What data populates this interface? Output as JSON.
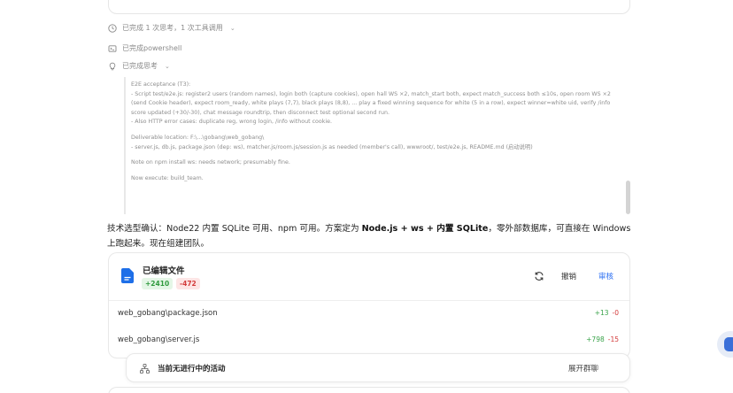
{
  "status": {
    "completed_thinking": "已完成 1 次思考，1 次工具调用",
    "completed_powershell": "已完成powershell",
    "completed_thought": "已完成思考"
  },
  "thinking": {
    "paragraphs": [
      "E2E acceptance (T3):\n- Script test/e2e.js: register2 users (random names), login both (capture cookies), open hall WS ×2, match_start both, expect match_success both ≤10s, open room WS ×2 (send Cookie header), expect room_ready, white plays (7,7), black plays (8,8), ... play a fixed winning sequence for white (5 in a row), expect winner=white uid, verify /info score updated (+30/-30), chat message roundtrip, then disconnect test optional second run.\n- Also HTTP error cases: duplicate reg, wrong login, /info without cookie.",
      "Deliverable location: F:\\...\\gobang\\web_gobang\\\n- server.js, db.js, package.json (dep: ws), matcher.js/room.js/session.js as needed (member's call), wwwroot/, test/e2e.js, README.md (启动说明)",
      "Note on npm install ws: needs network; presumably fine.",
      "Now execute: build_team."
    ]
  },
  "answer": {
    "prefix": "技术选型确认：Node22 内置 SQLite 可用、npm 可用。方案定为 ",
    "stack": "Node.js + ws + 内置 SQLite",
    "suffix": "，零外部数据库，可直接在 Windows 上跑起来。现在组建团队。"
  },
  "files_card": {
    "title": "已编辑文件",
    "added": "+2410",
    "removed": "-472",
    "undo_label": "撤销",
    "review_label": "审核",
    "files": [
      {
        "name": "web_gobang\\package.json",
        "added": "+13",
        "removed": "-0"
      },
      {
        "name": "web_gobang\\server.js",
        "added": "+798",
        "removed": "-15"
      }
    ]
  },
  "activity": {
    "text": "当前无进行中的活动",
    "expand_label": "展开群聊"
  },
  "colors": {
    "accent": "#2b6ff2",
    "added": "#3aa34a",
    "removed": "#d33b3b",
    "file_icon": "#1e6fe8"
  }
}
